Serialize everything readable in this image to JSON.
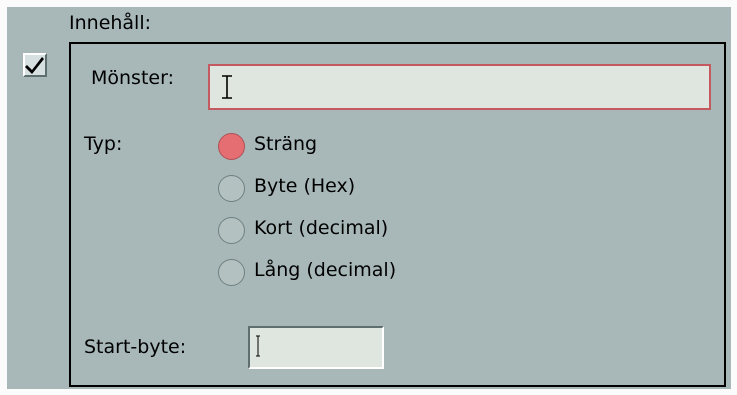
{
  "section": {
    "title": "Innehåll:",
    "enabled": true
  },
  "pattern": {
    "label": "Mönster:",
    "value": ""
  },
  "type": {
    "label": "Typ:",
    "options": [
      {
        "label": "Sträng",
        "selected": true
      },
      {
        "label": "Byte (Hex)",
        "selected": false
      },
      {
        "label": "Kort (decimal)",
        "selected": false
      },
      {
        "label": "Lång (decimal)",
        "selected": false
      }
    ],
    "selected_color": "#e46e72"
  },
  "start_byte": {
    "label": "Start-byte:",
    "value": ""
  },
  "colors": {
    "panel_background": "#a8b8b9",
    "field_background": "#dfe6df",
    "focus_border": "#c45a5f"
  }
}
